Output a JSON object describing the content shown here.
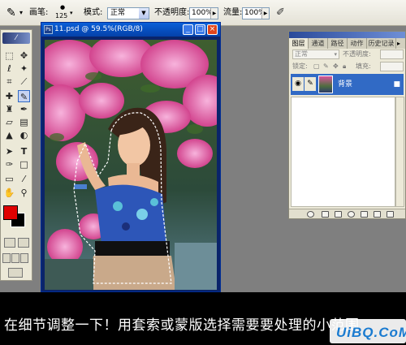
{
  "options_bar": {
    "brush_label": "画笔:",
    "brush_size": "125",
    "mode_label": "模式:",
    "mode_value": "正常",
    "opacity_label": "不透明度:",
    "opacity_value": "100%",
    "flow_label": "流量:",
    "flow_value": "100%"
  },
  "document": {
    "title": "11.psd @ 59.5%(RGB/8)",
    "minimize": "_",
    "maximize": "□",
    "close": "×"
  },
  "toolbox": {
    "foreground_color": "#e00000",
    "background_color": "#000000"
  },
  "layers_palette": {
    "tabs": [
      "图层",
      "通道",
      "路径",
      "动作",
      "历史记录"
    ],
    "blend_mode": "正常",
    "opacity_label": "不透明度:",
    "lock_label": "锁定:",
    "fill_label": "填充:",
    "layer_name": "背景"
  },
  "caption": {
    "text": "在细节调整一下！用套索或蒙版选择需要要处理的小范围"
  },
  "watermark": {
    "text": "UiBQ.CoM",
    "accent": "#1a7bd0"
  }
}
